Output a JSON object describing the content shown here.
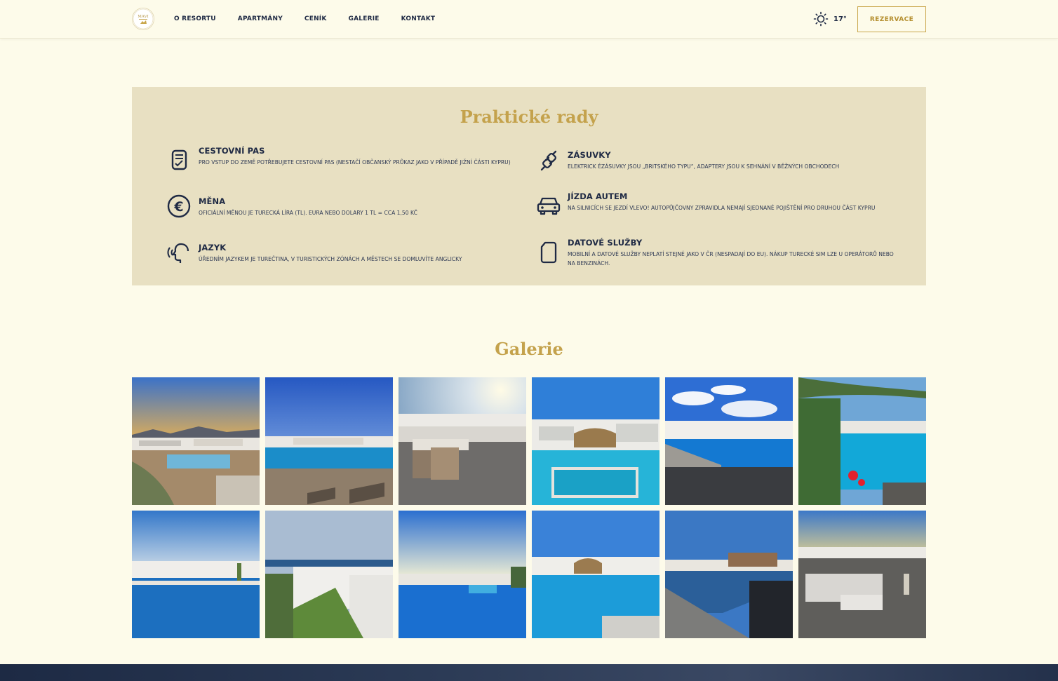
{
  "header": {
    "logo_text": "MAVI",
    "nav": [
      "O RESORTU",
      "APARTMÁNY",
      "CENÍK",
      "GALERIE",
      "KONTAKT"
    ],
    "weather_icon": "sun-icon",
    "temperature": "17°",
    "reserve_label": "REZERVACE"
  },
  "tips": {
    "title": "Praktické rady",
    "items": [
      {
        "icon": "passport-icon",
        "title": "CESTOVNÍ PAS",
        "text": "Pro vstup do země potřebujete cestovní pas (nestačí občanský průkaz jako v případě jižní části Kypru)"
      },
      {
        "icon": "euro-icon",
        "title": "MĚNA",
        "text": "Oficiální měnou je turecká líra (TL). Eura nebo dolary 1 TL = cca 1,50 Kč"
      },
      {
        "icon": "speech-icon",
        "title": "JAZYK",
        "text": "Úředním jazykem je turečtina, v turistických zónách a městech se domluvíte anglicky"
      },
      {
        "icon": "plug-icon",
        "title": "ZÁSUVKY",
        "text": "Elektrick ézásuvky jsou „britského typu“, adaptery jsou k sehnání v běžných obchodech"
      },
      {
        "icon": "car-icon",
        "title": "JÍZDA AUTEM",
        "text": "Na silnicích se jezdí vlevo! Autopůjčovny zpravidla nemají sjednané pojištění pro druhou část Kypru"
      },
      {
        "icon": "sim-icon",
        "title": "DATOVÉ SLUŽBY",
        "text": "Mobilní a datové služby neplatí stejné jako v ČR (nespadají do EU). Nákup turecké SIM lze u operátorů nebo na benzinách."
      }
    ]
  },
  "gallery": {
    "title": "Galerie",
    "photo_count": 12
  }
}
